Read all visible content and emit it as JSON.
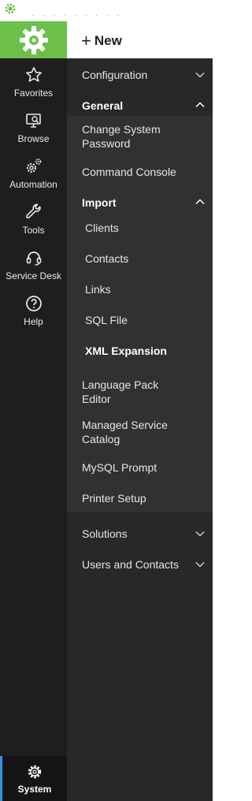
{
  "titlebar": {
    "text": "· ·  · · · · · · ·"
  },
  "rail": {
    "items": [
      {
        "label": "Favorites"
      },
      {
        "label": "Browse"
      },
      {
        "label": "Automation"
      },
      {
        "label": "Tools"
      },
      {
        "label": "Service Desk"
      },
      {
        "label": "Help"
      }
    ],
    "system_label": "System"
  },
  "new_button": {
    "label": "New"
  },
  "menu": {
    "configuration": "Configuration",
    "general": "General",
    "change_system_password": "Change System Password",
    "command_console": "Command Console",
    "import": "Import",
    "import_items": [
      "Clients",
      "Contacts",
      "Links",
      "SQL File",
      "XML Expansion"
    ],
    "language_pack_editor": "Language Pack Editor",
    "managed_service_catalog": "Managed Service Catalog",
    "mysql_prompt": "MySQL Prompt",
    "printer_setup": "Printer Setup",
    "solutions": "Solutions",
    "users_and_contacts": "Users and Contacts"
  },
  "colors": {
    "brand": "#6cc04a",
    "rail_bg": "#1e1e1e",
    "menu_bg": "#282828",
    "submenu_bg": "#313131",
    "active_indicator": "#3a8ee6"
  }
}
